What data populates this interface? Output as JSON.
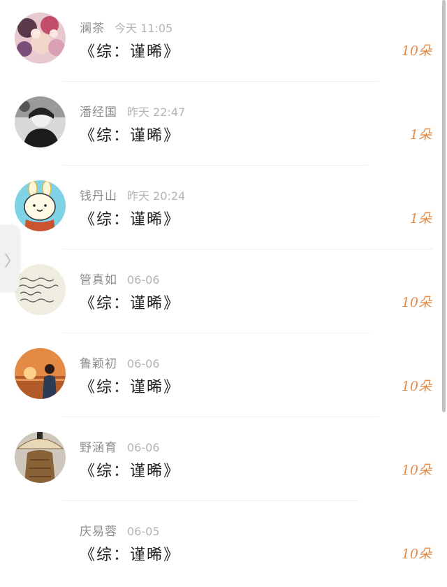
{
  "nav": {
    "collapse_glyph": "〉"
  },
  "items": [
    {
      "name": "澜茶",
      "time": "今天 11:05",
      "title": "《综：谨晞》",
      "count": "10朵",
      "avatar": "anime-group-avatar"
    },
    {
      "name": "潘经国",
      "time": "昨天 22:47",
      "title": "《综：谨晞》",
      "count": "1朵",
      "avatar": "bw-portrait-avatar"
    },
    {
      "name": "钱丹山",
      "time": "昨天 20:24",
      "title": "《综：谨晞》",
      "count": "1朵",
      "avatar": "bunny-sticker-avatar"
    },
    {
      "name": "管真如",
      "time": "06-06",
      "title": "《综：谨晞》",
      "count": "10朵",
      "avatar": "handwriting-note-avatar"
    },
    {
      "name": "鲁颖初",
      "time": "06-06",
      "title": "《综：谨晞》",
      "count": "10朵",
      "avatar": "sunset-girl-avatar"
    },
    {
      "name": "野涵育",
      "time": "06-06",
      "title": "《综：谨晞》",
      "count": "10朵",
      "avatar": "straw-hat-avatar"
    },
    {
      "name": "庆易蓉",
      "time": "06-05",
      "title": "《综：谨晞》",
      "count": "10朵",
      "avatar": ""
    }
  ],
  "colors": {
    "count": "#e28a48",
    "name": "#8c8c8c",
    "time": "#b3b3b3",
    "title": "#222222"
  }
}
